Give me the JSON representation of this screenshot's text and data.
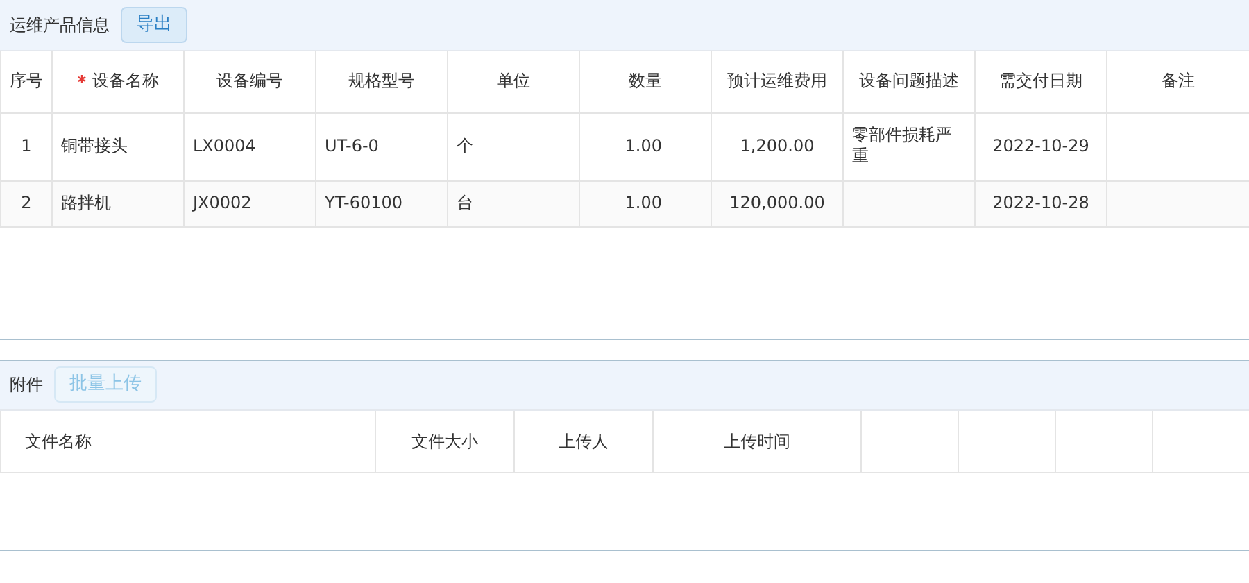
{
  "product_section": {
    "title": "运维产品信息",
    "export_button": {
      "label": "导出",
      "disabled": false
    }
  },
  "product_table": {
    "columns": [
      {
        "label": "序号",
        "required": false
      },
      {
        "label": "设备名称",
        "required": true
      },
      {
        "label": "设备编号",
        "required": false
      },
      {
        "label": "规格型号",
        "required": false
      },
      {
        "label": "单位",
        "required": false
      },
      {
        "label": "数量",
        "required": false
      },
      {
        "label": "预计运维费用",
        "required": false
      },
      {
        "label": "设备问题描述",
        "required": false
      },
      {
        "label": "需交付日期",
        "required": false
      },
      {
        "label": "备注",
        "required": false
      }
    ],
    "rows": [
      [
        "1",
        "铜带接头",
        "LX0004",
        "UT-6-0",
        "个",
        "1.00",
        "1,200.00",
        "零部件损耗严重",
        "2022-10-29",
        ""
      ],
      [
        "2",
        "路拌机",
        "JX0002",
        "YT-60100",
        "台",
        "1.00",
        "120,000.00",
        "",
        "2022-10-28",
        ""
      ]
    ]
  },
  "attachment_section": {
    "title": "附件",
    "upload_button": {
      "label": "批量上传",
      "disabled": true
    }
  },
  "attachment_table": {
    "columns": [
      "文件名称",
      "文件大小",
      "上传人",
      "上传时间"
    ]
  }
}
